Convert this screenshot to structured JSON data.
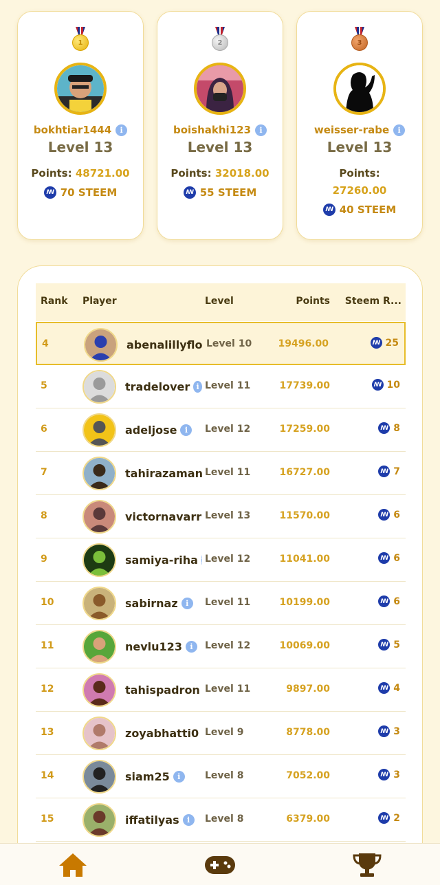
{
  "podium": [
    {
      "medal": "gold-medal",
      "name": "bokhtiar1444",
      "level": "Level 13",
      "points_label": "Points:",
      "points": "48721.00",
      "steem": "70 STEEM"
    },
    {
      "medal": "silver-medal",
      "name": "boishakhi123",
      "level": "Level 13",
      "points_label": "Points:",
      "points": "32018.00",
      "steem": "55 STEEM"
    },
    {
      "medal": "bronze-medal",
      "name": "weisser-rabe",
      "level": "Level 13",
      "points_label": "Points:",
      "points": "27260.00",
      "steem": "40 STEEM"
    }
  ],
  "medal_numbers": [
    "1",
    "2",
    "3"
  ],
  "table": {
    "headers": {
      "rank": "Rank",
      "player": "Player",
      "level": "Level",
      "points": "Points",
      "steem": "Steem R..."
    },
    "rows": [
      {
        "rank": "4",
        "player": "abenalillyflo",
        "level": "Level 10",
        "points": "19496.00",
        "steem": "25",
        "highlight": true
      },
      {
        "rank": "5",
        "player": "tradelover",
        "level": "Level 11",
        "points": "17739.00",
        "steem": "10"
      },
      {
        "rank": "6",
        "player": "adeljose",
        "level": "Level 12",
        "points": "17259.00",
        "steem": "8"
      },
      {
        "rank": "7",
        "player": "tahirazaman",
        "level": "Level 11",
        "points": "16727.00",
        "steem": "7"
      },
      {
        "rank": "8",
        "player": "victornavarr",
        "level": "Level 13",
        "points": "11570.00",
        "steem": "6"
      },
      {
        "rank": "9",
        "player": "samiya-riha",
        "level": "Level 12",
        "points": "11041.00",
        "steem": "6"
      },
      {
        "rank": "10",
        "player": "sabirnaz",
        "level": "Level 11",
        "points": "10199.00",
        "steem": "6"
      },
      {
        "rank": "11",
        "player": "nevlu123",
        "level": "Level 12",
        "points": "10069.00",
        "steem": "5"
      },
      {
        "rank": "12",
        "player": "tahispadron",
        "level": "Level 11",
        "points": "9897.00",
        "steem": "4"
      },
      {
        "rank": "13",
        "player": "zoyabhatti0",
        "level": "Level 9",
        "points": "8778.00",
        "steem": "3"
      },
      {
        "rank": "14",
        "player": "siam25",
        "level": "Level 8",
        "points": "7052.00",
        "steem": "3"
      },
      {
        "rank": "15",
        "player": "iffatilyas",
        "level": "Level 8",
        "points": "6379.00",
        "steem": "2"
      }
    ]
  },
  "nav": [
    {
      "icon": "home-icon",
      "active": true
    },
    {
      "icon": "gamepad-icon",
      "active": false
    },
    {
      "icon": "trophy-icon",
      "active": false
    }
  ],
  "colors": {
    "accent": "#d6a221",
    "background": "#fdf6df",
    "highlight_border": "#e7bd2a",
    "steem_blue": "#1e3caa",
    "nav_icon": "#c87900"
  }
}
